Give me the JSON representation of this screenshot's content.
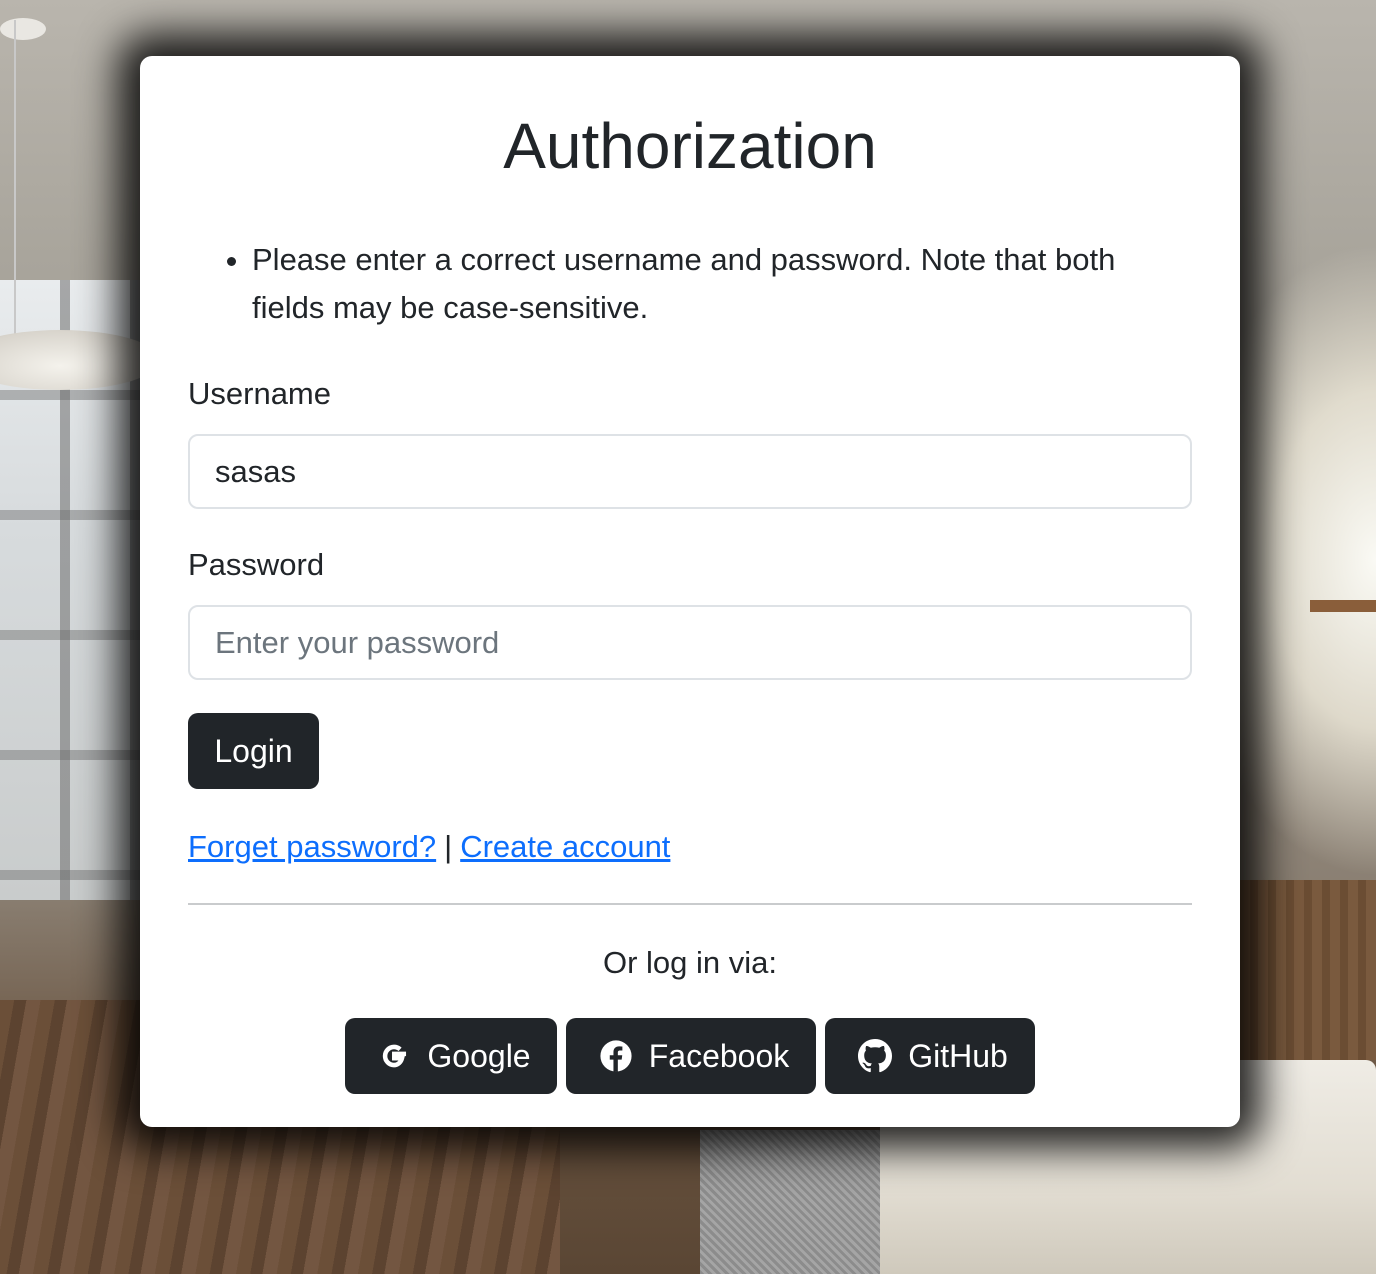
{
  "form": {
    "title": "Authorization",
    "errors": [
      "Please enter a correct username and password. Note that both fields may be case-sensitive."
    ],
    "username": {
      "label": "Username",
      "value": "sasas"
    },
    "password": {
      "label": "Password",
      "placeholder": "Enter your password"
    },
    "login_label": "Login",
    "forgot_label": "Forget password?",
    "separator": "|",
    "create_label": "Create account",
    "or_text": "Or log in via:"
  },
  "social": {
    "google_label": "Google",
    "facebook_label": "Facebook",
    "github_label": "GitHub"
  },
  "colors": {
    "button_bg": "#212529",
    "link": "#0d6efd",
    "text": "#212529"
  }
}
